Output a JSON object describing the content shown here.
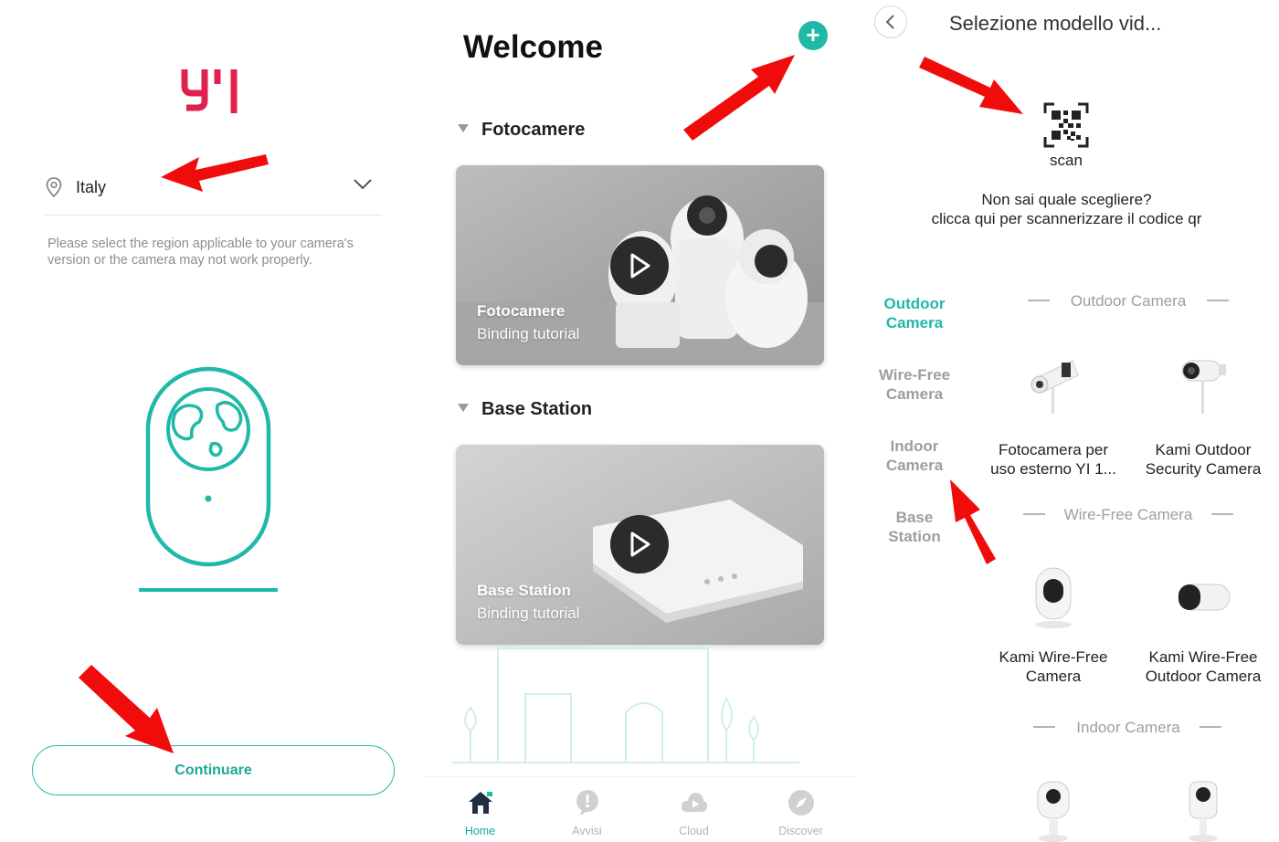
{
  "colors": {
    "accent": "#1fb9a8",
    "brand_red": "#e0204e",
    "arrow_red": "#f10c0c",
    "muted": "#9e9e9e"
  },
  "setup_screen": {
    "logo_text": "YI",
    "region_icon": "location-pin-icon",
    "region_value": "Italy",
    "region_hint": "Please select the region applicable to your camera's version or the camera may not work properly.",
    "continue_label": "Continuare"
  },
  "home_screen": {
    "title": "Welcome",
    "add_icon": "plus-icon",
    "sections": [
      {
        "title": "Fotocamere",
        "card_title": "Fotocamere",
        "card_subtitle": "Binding tutorial"
      },
      {
        "title": "Base Station",
        "card_title": "Base Station",
        "card_subtitle": "Binding tutorial"
      }
    ],
    "tabs": [
      {
        "label": "Home",
        "icon": "home-icon",
        "active": true
      },
      {
        "label": "Avvisi",
        "icon": "alert-icon",
        "active": false
      },
      {
        "label": "Cloud",
        "icon": "cloud-icon",
        "active": false
      },
      {
        "label": "Discover",
        "icon": "compass-icon",
        "active": false
      }
    ]
  },
  "model_screen": {
    "title": "Selezione modello vid...",
    "scan_label": "scan",
    "hint_line1": "Non sai quale scegliere?",
    "hint_line2": "clicca qui per scannerizzare il codice qr",
    "sidebar": [
      {
        "line1": "Outdoor",
        "line2": "Camera",
        "active": true
      },
      {
        "line1": "Wire-Free",
        "line2": "Camera",
        "active": false
      },
      {
        "line1": "Indoor",
        "line2": "Camera",
        "active": false
      },
      {
        "line1": "Base",
        "line2": "Station",
        "active": false
      }
    ],
    "groups": [
      {
        "title": "Outdoor Camera",
        "items": [
          {
            "line1": "Fotocamera per",
            "line2": "uso esterno YI 1..."
          },
          {
            "line1": "Kami Outdoor",
            "line2": "Security Camera"
          }
        ]
      },
      {
        "title": "Wire-Free Camera",
        "items": [
          {
            "line1": "Kami Wire-Free",
            "line2": "Camera"
          },
          {
            "line1": "Kami Wire-Free",
            "line2": "Outdoor Camera"
          }
        ]
      },
      {
        "title": "Indoor Camera",
        "items": []
      }
    ]
  }
}
